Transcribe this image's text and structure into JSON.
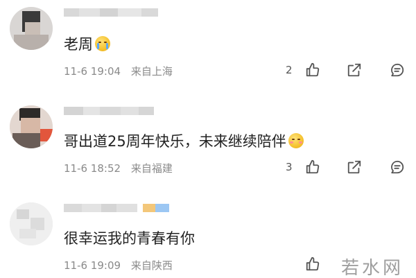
{
  "comments": [
    {
      "text": "老周",
      "emoji": "crying-face-emoji",
      "date": "11-6 19:04",
      "location": "来自上海",
      "likes": "2"
    },
    {
      "text": "哥出道25周年快乐，未来继续陪伴",
      "emoji": "blushing-face-emoji",
      "date": "11-6 18:52",
      "location": "来自福建",
      "likes": "3"
    },
    {
      "text": "很幸运我的青春有你",
      "date": "11-6 19:09",
      "location": "来自陕西"
    }
  ],
  "icons": {
    "like": "thumbs-up-icon",
    "share": "share-icon",
    "comment": "comment-icon"
  },
  "watermark": {
    "text": "若水网"
  },
  "colors": {
    "text": "#222222",
    "meta": "#8a8a8a",
    "icon": "#555555"
  }
}
